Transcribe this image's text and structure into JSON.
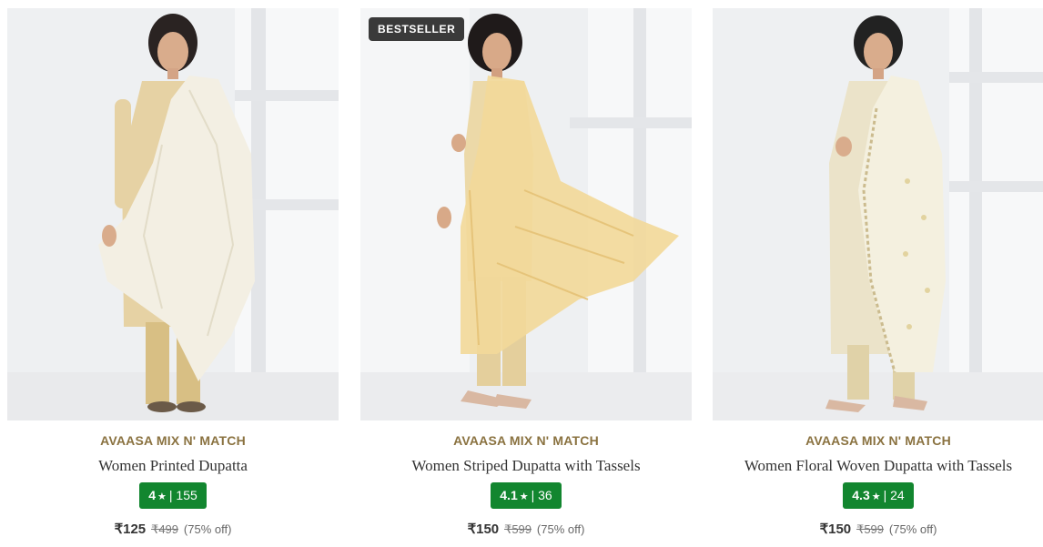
{
  "products": [
    {
      "badge": "",
      "brand": "AVAASA MIX N' MATCH",
      "name": "Women Printed Dupatta",
      "rating": "4",
      "reviews": "155",
      "price": "₹125",
      "mrp": "₹499",
      "discount": "(75% off)",
      "dupatta_color": "#f3efe3",
      "kurta_color": "#e6d2a4"
    },
    {
      "badge": "BESTSELLER",
      "brand": "AVAASA MIX N' MATCH",
      "name": "Women Striped Dupatta with Tassels",
      "rating": "4.1",
      "reviews": "36",
      "price": "₹150",
      "mrp": "₹599",
      "discount": "(75% off)",
      "dupatta_color": "#f2d99a",
      "kurta_color": "#ecd9a8"
    },
    {
      "badge": "",
      "brand": "AVAASA MIX N' MATCH",
      "name": "Women Floral Woven Dupatta with Tassels",
      "rating": "4.3",
      "reviews": "24",
      "price": "₹150",
      "mrp": "₹599",
      "discount": "(75% off)",
      "dupatta_color": "#f4f0df",
      "kurta_color": "#ebe3c9"
    }
  ],
  "icons": {
    "rating": "star-icon"
  },
  "colors": {
    "brand_text": "#8a7240",
    "rating_bg": "#12862f",
    "badge_bg": "#3a3a3a"
  }
}
